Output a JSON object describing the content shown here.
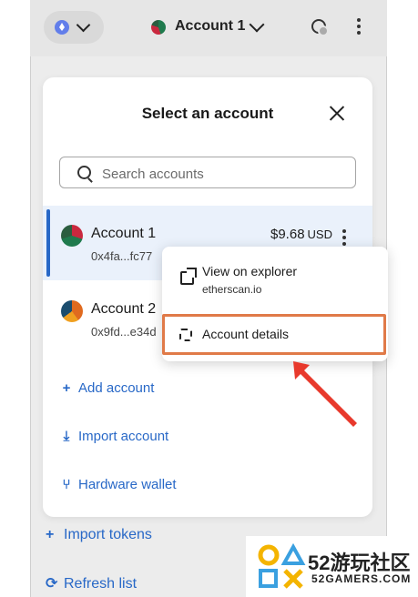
{
  "header": {
    "account_title": "Account 1"
  },
  "modal": {
    "title": "Select an account",
    "search": {
      "placeholder": "Search accounts",
      "value": ""
    },
    "accounts": [
      {
        "name": "Account 1",
        "address": "0x4fa...fc77",
        "balance": "$9.68",
        "currency": "USD",
        "selected": true
      },
      {
        "name": "Account 2",
        "address": "0x9fd...e34d",
        "selected": false
      }
    ],
    "actions": {
      "add": "Add account",
      "import": "Import account",
      "hardware": "Hardware wallet"
    }
  },
  "context_menu": {
    "view_on_explorer": "View on explorer",
    "explorer_host": "etherscan.io",
    "account_details": "Account details"
  },
  "page": {
    "import_tokens": "Import tokens",
    "refresh_list": "Refresh list"
  },
  "watermark": {
    "brand_cn": "52游玩社区",
    "brand_en": "52GAMERS.COM"
  },
  "colors": {
    "link": "#2868c7",
    "highlight": "#e07a48",
    "arrow": "#e8392c",
    "selected_row": "#eaf1fb"
  },
  "icons": [
    "ethereum-icon",
    "chevron-down-icon",
    "globe-icon",
    "kebab-icon",
    "close-icon",
    "search-icon",
    "plus-icon",
    "import-icon",
    "hardware-icon",
    "external-link-icon",
    "qr-icon",
    "refresh-icon"
  ]
}
